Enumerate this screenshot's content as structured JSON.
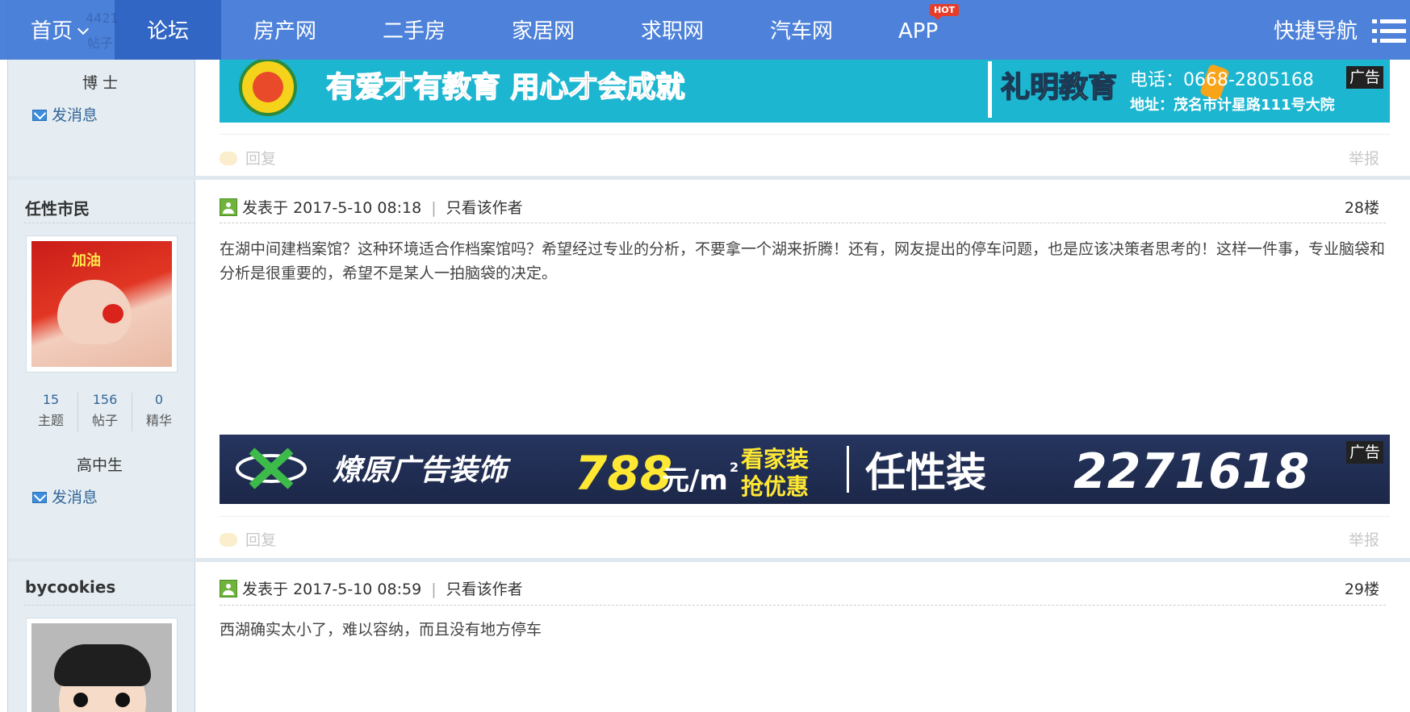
{
  "nav": {
    "items": [
      "首页",
      "论坛",
      "房产网",
      "二手房",
      "家居网",
      "求职网",
      "汽车网",
      "APP"
    ],
    "hot_badge": "HOT",
    "quick_nav": "快捷导航",
    "faded_count": "4421",
    "faded_label": "帖子"
  },
  "prev_user": {
    "rank": "博士",
    "send_message": "发消息"
  },
  "ads": [
    {
      "slogan": "有爱才有教育 用心才会成就",
      "brand": "礼明教育",
      "phone": "电话：0668-2805168",
      "address": "地址：茂名市计星路111号大院",
      "tag": "广告"
    },
    {
      "brand": "燎原广告装饰",
      "price": "788",
      "unit": "元/m",
      "unit_sup": "2",
      "promo_line1": "看家装",
      "promo_line2": "抢优惠",
      "slogan": "任性装",
      "phone": "2271618",
      "tag": "广告"
    }
  ],
  "reply_label": "回复",
  "report_label": "举报",
  "posts": [
    {
      "author": "任性市民",
      "posted_prefix": "发表于",
      "posted_time": "2017-5-10 08:18",
      "only_author": "只看该作者",
      "floor": "28楼",
      "body": "在湖中间建档案馆？这种环境适合作档案馆吗？希望经过专业的分析，不要拿一个湖来折腾！还有，网友提出的停车问题，也是应该决策者思考的！这样一件事，专业脑袋和分析是很重要的，希望不是某人一拍脑袋的决定。",
      "avatar_text": "加油",
      "stats": [
        {
          "value": "15",
          "label": "主题"
        },
        {
          "value": "156",
          "label": "帖子"
        },
        {
          "value": "0",
          "label": "精华"
        }
      ],
      "rank": "高中生",
      "send_message": "发消息"
    },
    {
      "author": "bycookies",
      "posted_prefix": "发表于",
      "posted_time": "2017-5-10 08:59",
      "only_author": "只看该作者",
      "floor": "29楼",
      "body": "西湖确实太小了，难以容纳，而且没有地方停车"
    }
  ],
  "colors": {
    "nav_bg": "#4178d7",
    "link": "#336699",
    "sidebar_bg": "#e5edf2"
  }
}
